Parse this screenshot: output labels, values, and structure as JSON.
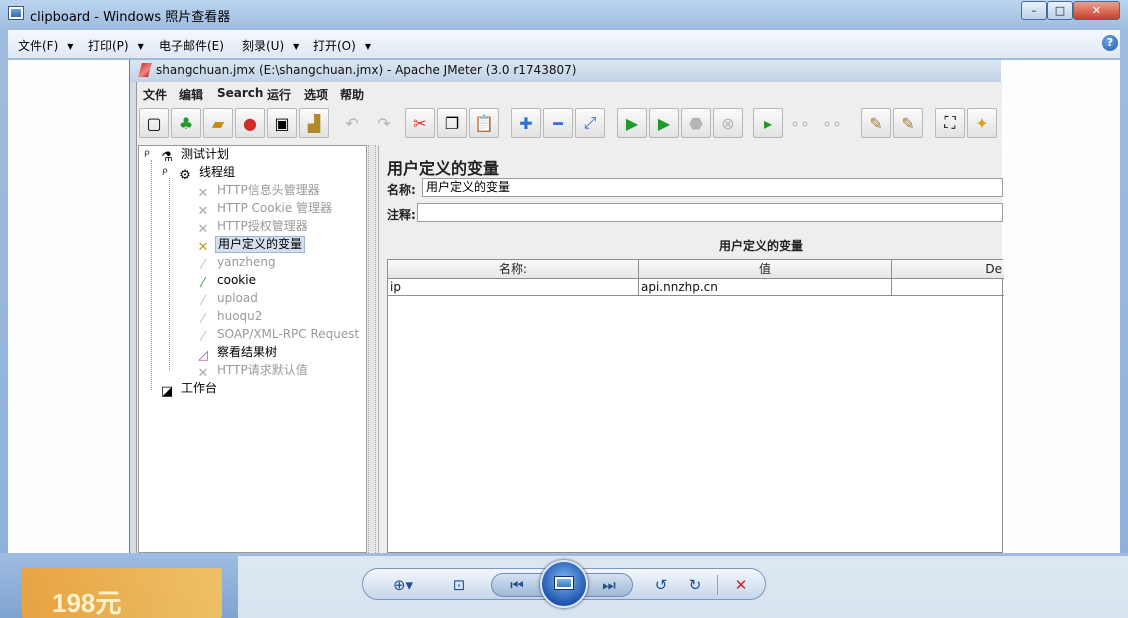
{
  "photo_viewer": {
    "title": "clipboard - Windows 照片查看器",
    "window_buttons": {
      "minimize": "–",
      "maximize": "□",
      "close": "✕"
    },
    "menu": {
      "file": "文件(F)",
      "print": "打印(P)",
      "email": "电子邮件(E)",
      "burn": "刻录(U)",
      "open": "打开(O)"
    },
    "help_icon": "?",
    "controls": {
      "zoom": "⊕▾",
      "fit": "⊡",
      "prev": "⏮",
      "next": "⏭",
      "rotate_ccw": "↺",
      "rotate_cw": "↻",
      "delete": "✕"
    },
    "background_ad_text": "198元"
  },
  "jmeter": {
    "title": "shangchuan.jmx (E:\\shangchuan.jmx) - Apache JMeter (3.0 r1743807)",
    "menu": [
      "文件",
      "编辑",
      "Search",
      "运行",
      "选项",
      "帮助"
    ],
    "tree": [
      {
        "label": "测试计划",
        "icon": "flask-icon",
        "disabled": false,
        "selected": false
      },
      {
        "label": "线程组",
        "icon": "gear-icon",
        "disabled": false,
        "selected": false
      },
      {
        "label": "HTTP信息头管理器",
        "icon": "wrench-icon",
        "disabled": true,
        "selected": false
      },
      {
        "label": "HTTP Cookie 管理器",
        "icon": "wrench-icon",
        "disabled": true,
        "selected": false
      },
      {
        "label": "HTTP授权管理器",
        "icon": "wrench-icon",
        "disabled": true,
        "selected": false
      },
      {
        "label": "用户定义的变量",
        "icon": "wrench-icon",
        "disabled": false,
        "selected": true
      },
      {
        "label": "yanzheng",
        "icon": "pipette-icon",
        "disabled": true,
        "selected": false
      },
      {
        "label": "cookie",
        "icon": "pipette-icon",
        "disabled": false,
        "selected": false
      },
      {
        "label": "upload",
        "icon": "pipette-icon",
        "disabled": true,
        "selected": false
      },
      {
        "label": "huoqu2",
        "icon": "pipette-icon",
        "disabled": true,
        "selected": false
      },
      {
        "label": "SOAP/XML-RPC Request",
        "icon": "pipette-icon",
        "disabled": true,
        "selected": false
      },
      {
        "label": "察看结果树",
        "icon": "chart-icon",
        "disabled": false,
        "selected": false
      },
      {
        "label": "HTTP请求默认值",
        "icon": "wrench-icon",
        "disabled": true,
        "selected": false
      },
      {
        "label": "工作台",
        "icon": "workbench-icon",
        "disabled": false,
        "selected": false
      }
    ],
    "panel": {
      "title": "用户定义的变量",
      "name_label": "名称:",
      "name_value": "用户定义的变量",
      "comment_label": "注释:",
      "comment_value": "",
      "table_caption": "用户定义的变量",
      "columns": [
        "名称:",
        "值",
        "De"
      ],
      "rows": [
        [
          "ip",
          "api.nnzhp.cn",
          ""
        ]
      ]
    }
  }
}
